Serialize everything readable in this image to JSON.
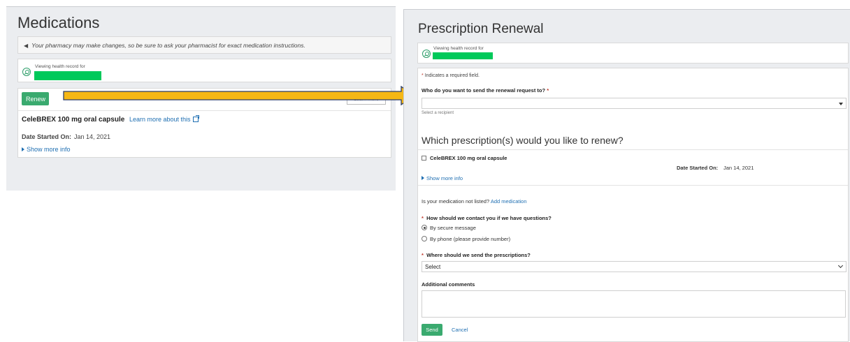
{
  "colors": {
    "accent_green": "#3aaa6f",
    "link_blue": "#1f6fb2",
    "arrow_fill": "#f5b715",
    "panel_bg": "#ebedf0"
  },
  "left": {
    "title": "Medications",
    "notice_icon": "megaphone-icon",
    "notice": "Your pharmacy may make changes, so be sure to ask your pharmacist for exact medication instructions.",
    "viewing_label": "Viewing health record for",
    "renew_label": "Renew",
    "learn_more_btn": "Learn more",
    "med_name": "CeleBREX 100 mg oral capsule",
    "learn_more_link": "Learn more about this",
    "date_label": "Date Started On:",
    "date_value": "Jan 14, 2021",
    "show_more": "Show more info"
  },
  "right": {
    "title": "Prescription Renewal",
    "viewing_label": "Viewing health record for",
    "required_note": "Indicates a required field.",
    "required_star": "*",
    "q_recipient": "Who do you want to send the renewal request to?",
    "recipient_value": "",
    "recipient_hint": "Select a recipient",
    "section_title": "Which prescription(s) would you like to renew?",
    "med_name": "CeleBREX 100 mg oral capsule",
    "date_label": "Date Started On:",
    "date_value": "Jan 14, 2021",
    "show_more": "Show more info",
    "not_listed": "Is your medication not listed?",
    "add_medication": "Add medication",
    "q_contact": "How should we contact you if we have questions?",
    "contact_options": [
      "By secure message",
      "By phone (please provide number)"
    ],
    "contact_selected": "By secure message",
    "q_pharmacy": "Where should we send the prescriptions?",
    "pharmacy_value": "Select",
    "comments_label": "Additional comments",
    "comments_value": "",
    "send_label": "Send",
    "cancel_label": "Cancel"
  }
}
